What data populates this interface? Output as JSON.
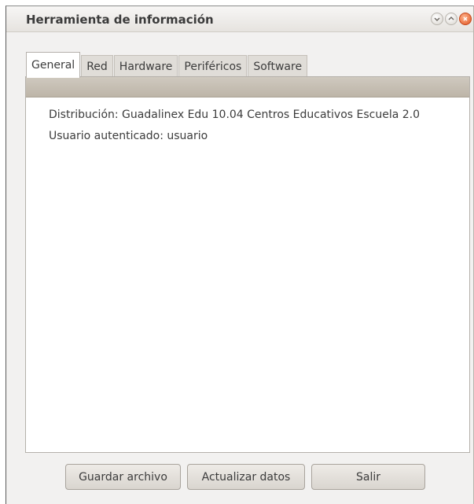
{
  "window": {
    "title": "Herramienta de información",
    "controls": [
      {
        "icon": "minimize-icon"
      },
      {
        "icon": "maximize-icon"
      },
      {
        "icon": "close-icon"
      }
    ]
  },
  "tabs": [
    {
      "label": "General",
      "active": true
    },
    {
      "label": "Red",
      "active": false
    },
    {
      "label": "Hardware",
      "active": false
    },
    {
      "label": "Periféricos",
      "active": false
    },
    {
      "label": "Software",
      "active": false
    }
  ],
  "general": {
    "lines": [
      "Distribución: Guadalinex Edu 10.04 Centros Educativos Escuela 2.0",
      "Usuario autenticado: usuario"
    ]
  },
  "buttons": {
    "save": "Guardar archivo",
    "update": "Actualizar datos",
    "exit": "Salir"
  },
  "colors": {
    "header_bar": "#c8c1b6",
    "close_button": "#e0531f",
    "window_bg": "#f2f1f0"
  }
}
